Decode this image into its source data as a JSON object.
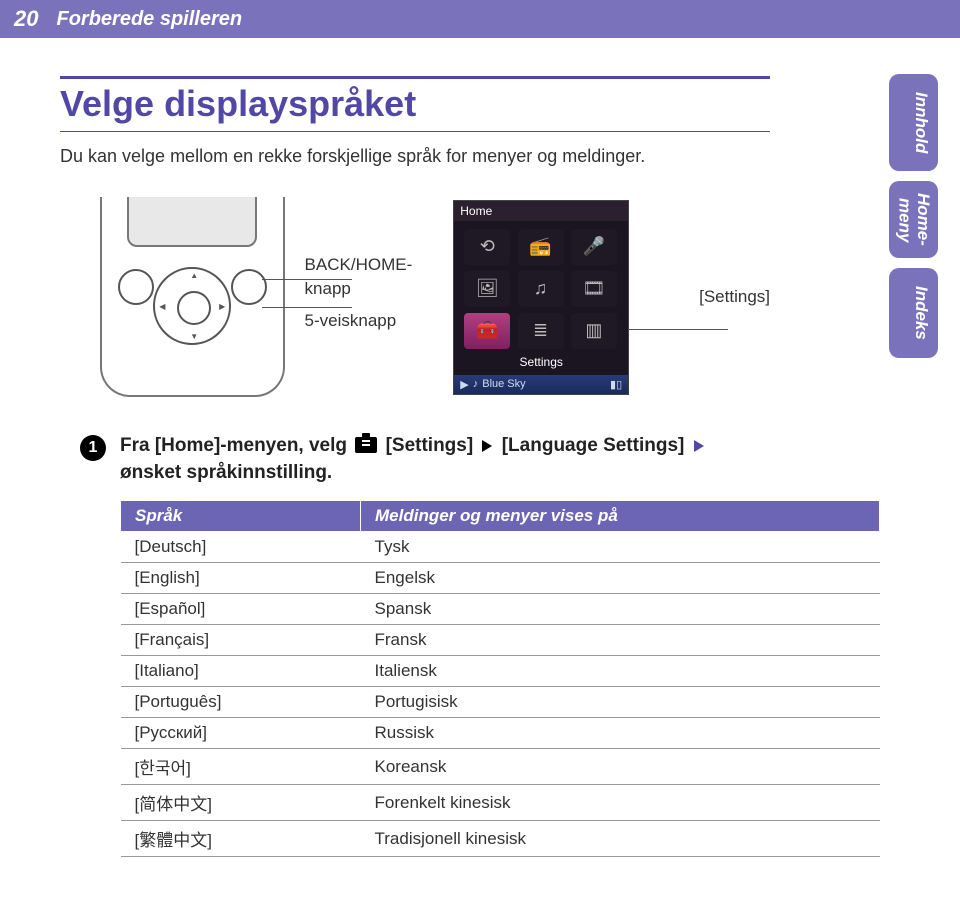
{
  "header": {
    "page_number": "20",
    "section": "Forberede spilleren"
  },
  "title": "Velge displayspråket",
  "intro": "Du kan velge mellom en rekke forskjellige språk for menyer og meldinger.",
  "figure": {
    "back_home_label": "BACK/HOME-knapp",
    "fiveway_label": "5-veisknapp",
    "settings_label": "[Settings]"
  },
  "screenshot": {
    "title": "Home",
    "selected_label": "Settings",
    "footer_track": "Blue Sky",
    "footer_play_icon": "▶",
    "footer_note_icon": "♪",
    "battery_icon": "▮▯"
  },
  "step": {
    "number": "1",
    "part1": "Fra [Home]-menyen, velg",
    "settings": " [Settings] ",
    "langset": "[Language Settings] ",
    "part2": "ønsket språkinnstilling."
  },
  "table": {
    "header_left": "Språk",
    "header_right": "Meldinger og menyer vises på",
    "rows": [
      {
        "l": "[Deutsch]",
        "r": "Tysk"
      },
      {
        "l": "[English]",
        "r": "Engelsk"
      },
      {
        "l": "[Español]",
        "r": "Spansk"
      },
      {
        "l": "[Français]",
        "r": "Fransk"
      },
      {
        "l": "[Italiano]",
        "r": "Italiensk"
      },
      {
        "l": "[Português]",
        "r": "Portugisisk"
      },
      {
        "l": "[Русский]",
        "r": "Russisk"
      },
      {
        "l": "[한국어]",
        "r": "Koreansk"
      },
      {
        "l": "[简体中文]",
        "r": "Forenkelt kinesisk"
      },
      {
        "l": "[繁體中文]",
        "r": "Tradisjonell kinesisk"
      }
    ]
  },
  "tabs": {
    "t1": "Innhold",
    "t2a": "Home-",
    "t2b": "meny",
    "t3": "Indeks"
  }
}
